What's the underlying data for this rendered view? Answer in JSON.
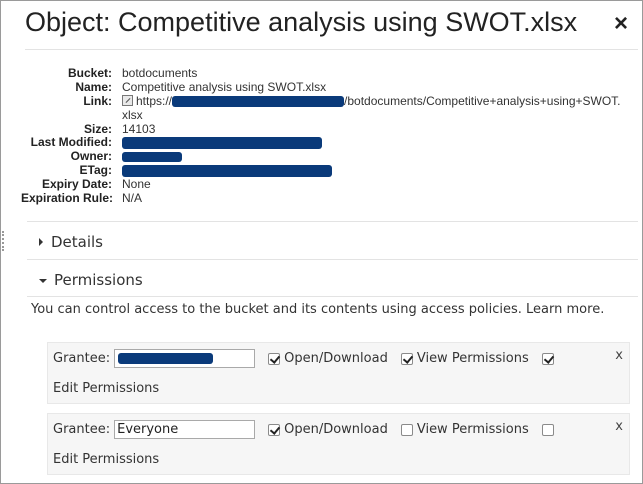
{
  "title": "Object: Competitive analysis using SWOT.xlsx",
  "close_label": "×",
  "meta": {
    "bucket_label": "Bucket:",
    "bucket": "botdocuments",
    "name_label": "Name:",
    "name": "Competitive analysis using SWOT.xlsx",
    "link_label": "Link:",
    "link_prefix": "https://",
    "link_suffix": "/botdocuments/Competitive+analysis+using+SWOT.xlsx",
    "size_label": "Size:",
    "size": "14103",
    "last_modified_label": "Last Modified:",
    "owner_label": "Owner:",
    "etag_label": "ETag:",
    "expiry_date_label": "Expiry Date:",
    "expiry_date": "None",
    "expiration_rule_label": "Expiration Rule:",
    "expiration_rule": "N/A"
  },
  "sections": {
    "details": "Details",
    "permissions": "Permissions"
  },
  "permissions": {
    "info_text": "You can control access to the bucket and its contents using access policies.",
    "learn_more": "Learn more.",
    "grantees": [
      {
        "grantee_label": "Grantee:",
        "grantee_value": "",
        "redacted": true,
        "open_download_label": "Open/Download",
        "open_download_checked": true,
        "view_permissions_label": "View Permissions",
        "view_permissions_checked": true,
        "edit_permissions_label": "Edit Permissions",
        "edit_permissions_checked": true,
        "remove_label": "x"
      },
      {
        "grantee_label": "Grantee:",
        "grantee_value": "Everyone",
        "redacted": false,
        "open_download_label": "Open/Download",
        "open_download_checked": true,
        "view_permissions_label": "View Permissions",
        "view_permissions_checked": false,
        "edit_permissions_label": "Edit Permissions",
        "edit_permissions_checked": false,
        "remove_label": "x"
      }
    ]
  },
  "colors": {
    "redaction": "#0a3a7a",
    "grantee_bg": "#f6f6f6",
    "border": "#9a9a9a"
  }
}
